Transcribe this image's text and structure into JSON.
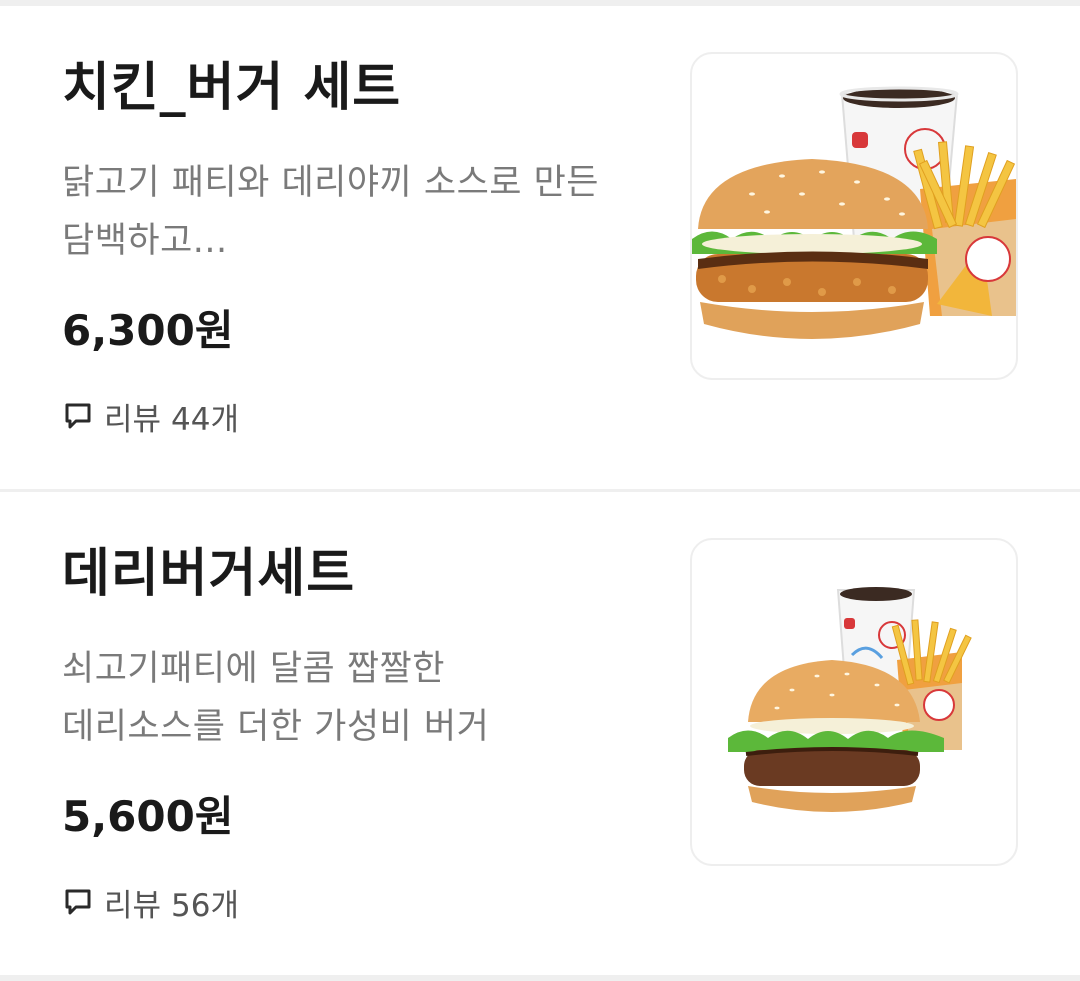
{
  "menu_items": [
    {
      "name": "치킨_버거 세트",
      "description_lines": [
        "닭고기 패티와 데리야끼 소스로 만든",
        "담백하고..."
      ],
      "price": "6,300원",
      "review_label": "리뷰",
      "review_count": "44개",
      "image_icon": "chicken-burger-set-photo"
    },
    {
      "name": "데리버거세트",
      "description_lines": [
        "쇠고기패티에 달콤 짭짤한",
        "데리소스를 더한 가성비 버거"
      ],
      "price": "5,600원",
      "review_label": "리뷰",
      "review_count": "56개",
      "image_icon": "teri-burger-set-photo"
    }
  ],
  "colors": {
    "title": "#1a1a1a",
    "description": "#7a7a7a",
    "review": "#555555",
    "divider": "#efefef"
  }
}
